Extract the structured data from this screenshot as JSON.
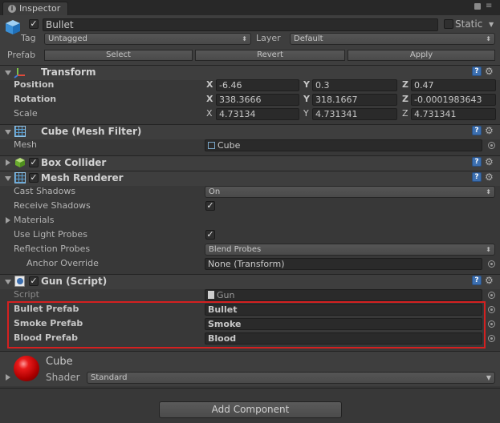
{
  "tab": {
    "label": "Inspector"
  },
  "object": {
    "name": "Bullet",
    "static_label": "Static",
    "tag_label": "Tag",
    "tag_value": "Untagged",
    "layer_label": "Layer",
    "layer_value": "Default"
  },
  "prefab": {
    "label": "Prefab",
    "select": "Select",
    "revert": "Revert",
    "apply": "Apply"
  },
  "transform": {
    "title": "Transform",
    "position": {
      "label": "Position",
      "x": "-6.46",
      "y": "0.3",
      "z": "0.47"
    },
    "rotation": {
      "label": "Rotation",
      "x": "338.3666",
      "y": "318.1667",
      "z": "-0.0001983643"
    },
    "scale": {
      "label": "Scale",
      "x": "4.73134",
      "y": "4.731341",
      "z": "4.731341"
    },
    "axis": {
      "x": "X",
      "y": "Y",
      "z": "Z"
    }
  },
  "mesh_filter": {
    "title": "Cube (Mesh Filter)",
    "mesh_label": "Mesh",
    "mesh_value": "Cube"
  },
  "box_collider": {
    "title": "Box Collider"
  },
  "mesh_renderer": {
    "title": "Mesh Renderer",
    "cast_shadows_label": "Cast Shadows",
    "cast_shadows_value": "On",
    "receive_shadows_label": "Receive Shadows",
    "materials_label": "Materials",
    "light_probes_label": "Use Light Probes",
    "reflection_probes_label": "Reflection Probes",
    "reflection_probes_value": "Blend Probes",
    "anchor_label": "Anchor Override",
    "anchor_value": "None (Transform)"
  },
  "gun": {
    "title": "Gun (Script)",
    "script_label": "Script",
    "script_value": "Gun",
    "bullet_label": "Bullet Prefab",
    "bullet_value": "Bullet",
    "smoke_label": "Smoke Prefab",
    "smoke_value": "Smoke",
    "blood_label": "Blood Prefab",
    "blood_value": "Blood"
  },
  "material": {
    "name": "Cube",
    "shader_label": "Shader",
    "shader_value": "Standard"
  },
  "add_component": "Add Component",
  "colors": {
    "highlight_border": "#d42020",
    "material_sphere": "#cc1111",
    "help_icon": "#3c6fb0"
  }
}
